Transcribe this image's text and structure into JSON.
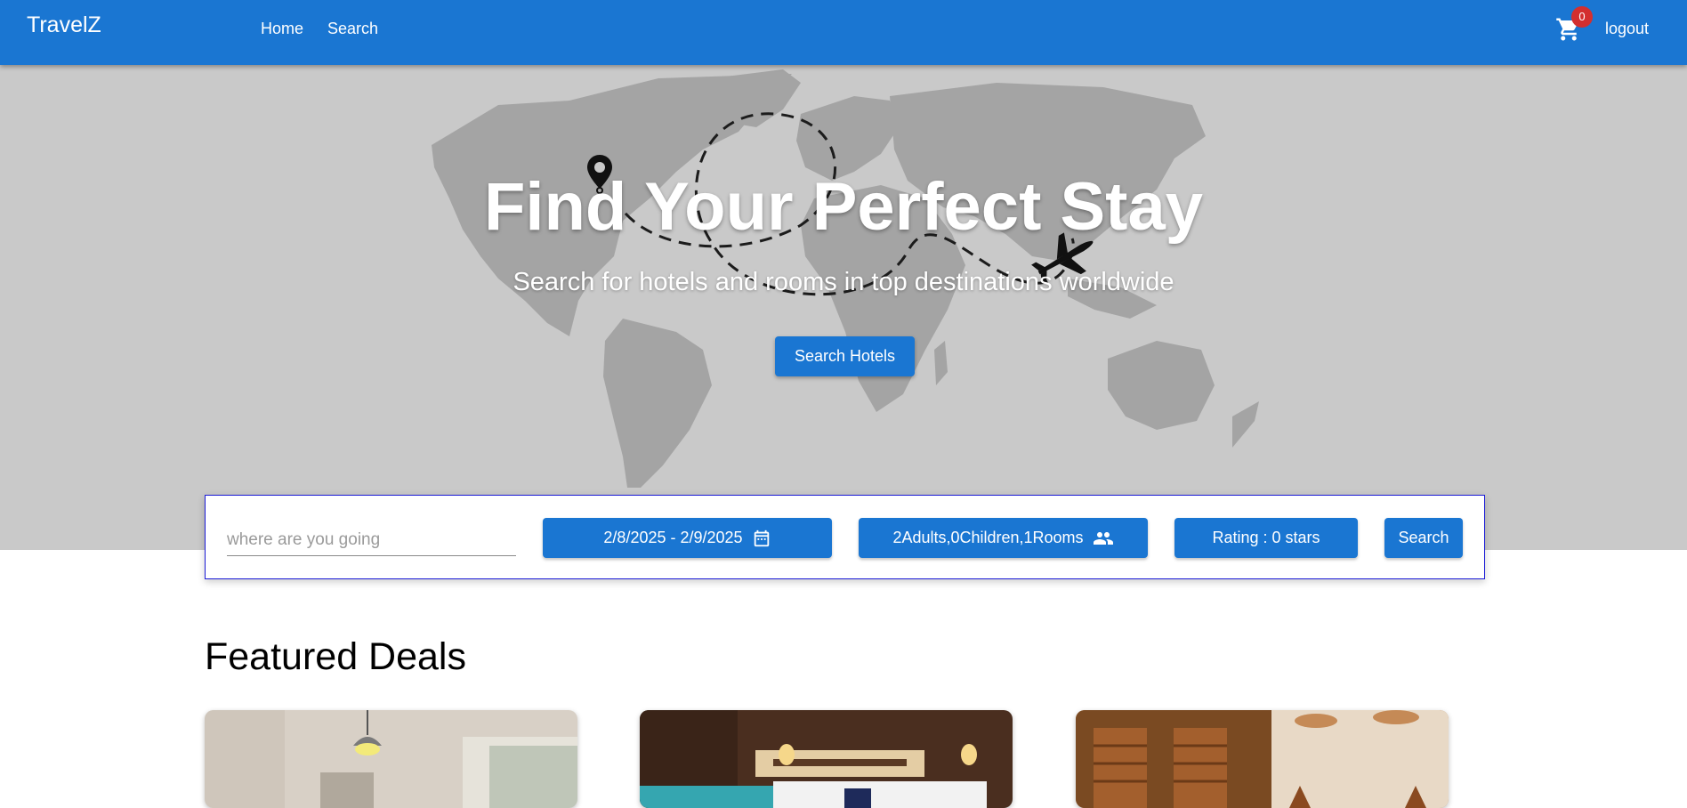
{
  "header": {
    "brand": "TravelZ",
    "nav": [
      "Home",
      "Search"
    ],
    "cart_count": "0",
    "logout_label": "logout",
    "icon": "cart-icon"
  },
  "hero": {
    "title": "Find Your Perfect Stay",
    "subtitle": "Search for hotels and rooms in top destinations worldwide",
    "button_label": "Search Hotels"
  },
  "search": {
    "destination_placeholder": "where are you going",
    "destination_value": "",
    "dates_label": "2/8/2025 - 2/9/2025",
    "guests_label": "2Adults,0Children,1Rooms",
    "rating_label": "Rating : 0 stars",
    "search_label": "Search"
  },
  "featured": {
    "title": "Featured Deals",
    "cards": [
      {
        "name": "deal-card-1"
      },
      {
        "name": "deal-card-2"
      },
      {
        "name": "deal-card-3"
      }
    ]
  },
  "colors": {
    "primary": "#1a76d2",
    "badge": "#d32f2f",
    "hero_bg": "#c9c9c9"
  }
}
